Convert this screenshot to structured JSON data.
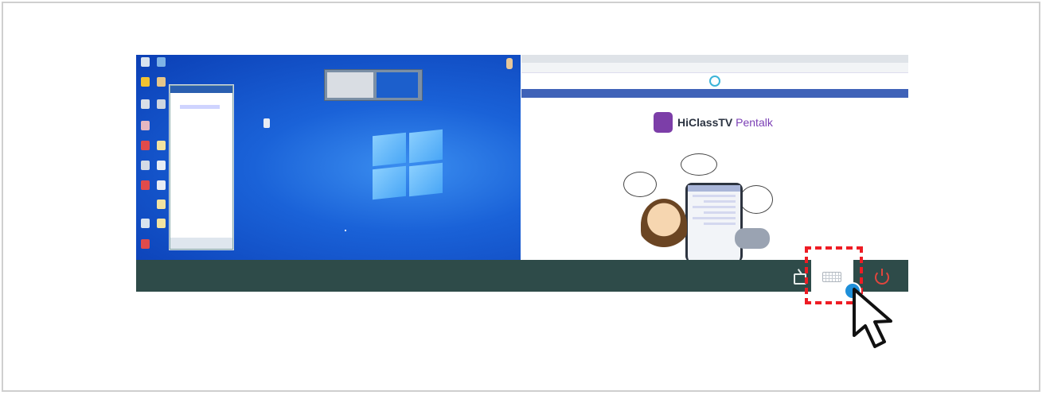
{
  "browser_page": {
    "brand_name": "HiClassTV",
    "product_name": "Pentalk"
  },
  "taskbar": {
    "icons": [
      "tv-icon",
      "keyboard-icon",
      "power-icon"
    ]
  },
  "annotation": {
    "highlight_color": "#ee1c24",
    "click_indicator_color": "#1e8fd9",
    "highlighted_item": "keyboard-button"
  },
  "colors": {
    "taskbar": "#2e4b49",
    "desktop": "#1a62d8",
    "power_icon": "#e0463e"
  }
}
